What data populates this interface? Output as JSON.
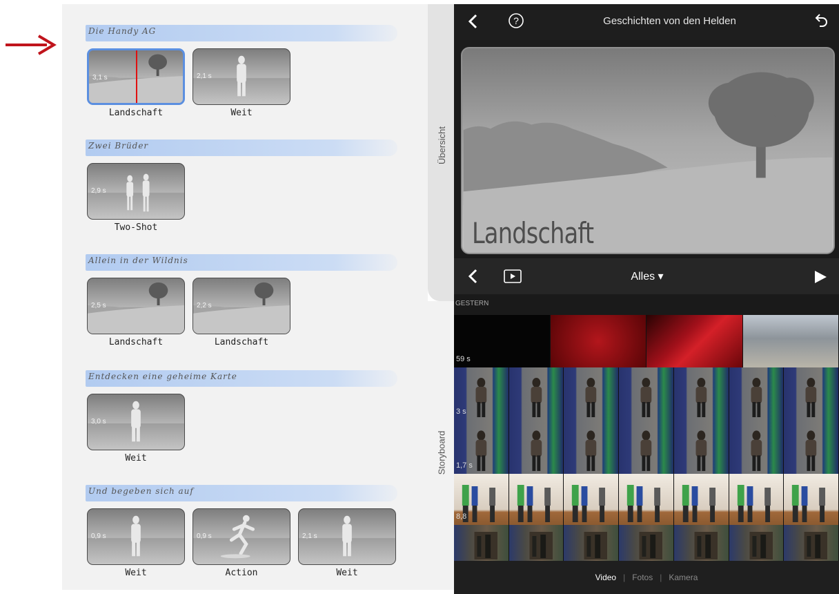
{
  "storyboard": {
    "side_tab_label": "Übersicht",
    "sections": [
      {
        "title": "Die Handy AG",
        "clips": [
          {
            "duration": "3,1 s",
            "label": "Landschaft",
            "art": "landscape",
            "selected": true
          },
          {
            "duration": "2,1 s",
            "label": "Weit",
            "art": "person"
          }
        ]
      },
      {
        "title": "Zwei Brüder",
        "clips": [
          {
            "duration": "2,9 s",
            "label": "Two-Shot",
            "art": "twoshot"
          }
        ]
      },
      {
        "title": "Allein in der Wildnis",
        "clips": [
          {
            "duration": "2,5 s",
            "label": "Landschaft",
            "art": "landscape"
          },
          {
            "duration": "2,2 s",
            "label": "Landschaft",
            "art": "landscape"
          }
        ]
      },
      {
        "title": "Entdecken eine geheime Karte",
        "clips": [
          {
            "duration": "3,0 s",
            "label": "Weit",
            "art": "person"
          }
        ]
      },
      {
        "title": "Und begeben sich auf",
        "clips": [
          {
            "duration": "0,9 s",
            "label": "Weit",
            "art": "person"
          },
          {
            "duration": "0,9 s",
            "label": "Action",
            "art": "runner"
          },
          {
            "duration": "2,1 s",
            "label": "Weit",
            "art": "person"
          }
        ]
      }
    ]
  },
  "side_label_bottom": "Storyboard",
  "topbar": {
    "title": "Geschichten von den Helden",
    "back_icon": "chevron-left-icon",
    "help_icon": "help-icon",
    "undo_icon": "undo-icon"
  },
  "viewer": {
    "caption": "Landschaft"
  },
  "browser": {
    "filter_label": "Alles ▾",
    "back_icon": "chevron-left-icon",
    "preview_icon": "preview-icon",
    "play_icon": "play-icon"
  },
  "media": {
    "section_date": "GESTERN",
    "rows": [
      {
        "badge": "59 s",
        "kind": "intro"
      },
      {
        "badge": "3 s",
        "kind": "boy"
      },
      {
        "badge": "1,7 s",
        "kind": "boy2"
      },
      {
        "badge": "8,8",
        "kind": "group"
      },
      {
        "badge": "",
        "kind": "shelf"
      }
    ]
  },
  "bottom_tabs": [
    "Video",
    "Fotos",
    "Kamera"
  ],
  "colors": {
    "accent_red": "#c0141c",
    "selection_blue": "#5b8fe0"
  }
}
